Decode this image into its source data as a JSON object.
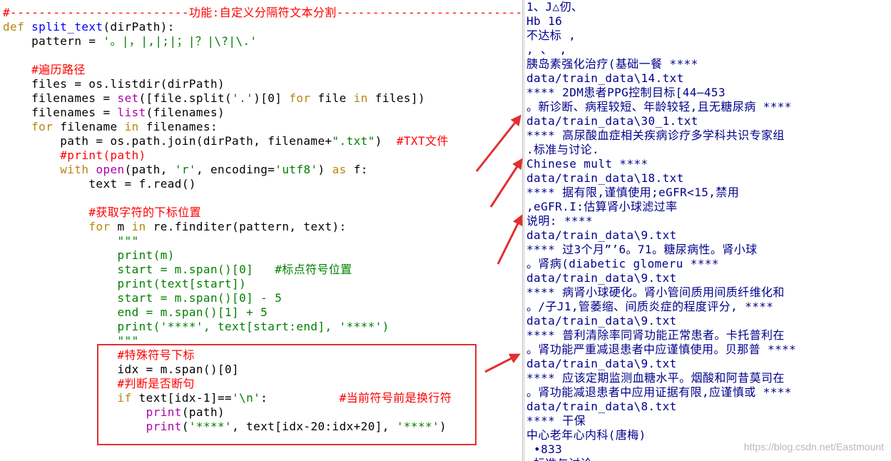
{
  "colors": {
    "comment": "#ff0000",
    "keyword": "#b8860b",
    "builtin": "#b000b0",
    "string": "#008000",
    "def_name": "#0000ff",
    "output_text": "#00008b",
    "annotation": "#e03030"
  },
  "editor": {
    "lines": [
      [
        {
          "t": "#-------------------------功能:自定义分隔符文本分割-----------------------------------",
          "c": "comment"
        }
      ],
      [
        {
          "t": "def ",
          "c": "keyword"
        },
        {
          "t": "split_text",
          "c": "defname"
        },
        {
          "t": "(dirPath):",
          "c": "plain"
        }
      ],
      [
        {
          "t": "    pattern = ",
          "c": "plain"
        },
        {
          "t": "'。|，|,|;|；|？|\\?|\\.'",
          "c": "string"
        }
      ],
      [],
      [
        {
          "t": "    #遍历路径",
          "c": "comment"
        }
      ],
      [
        {
          "t": "    files = os.listdir(dirPath)",
          "c": "plain"
        }
      ],
      [
        {
          "t": "    filenames = ",
          "c": "plain"
        },
        {
          "t": "set",
          "c": "builtin"
        },
        {
          "t": "([file.split(",
          "c": "plain"
        },
        {
          "t": "'.'",
          "c": "string"
        },
        {
          "t": ")[0] ",
          "c": "plain"
        },
        {
          "t": "for",
          "c": "keyword"
        },
        {
          "t": " file ",
          "c": "plain"
        },
        {
          "t": "in",
          "c": "keyword"
        },
        {
          "t": " files])",
          "c": "plain"
        }
      ],
      [
        {
          "t": "    filenames = ",
          "c": "plain"
        },
        {
          "t": "list",
          "c": "builtin"
        },
        {
          "t": "(filenames)",
          "c": "plain"
        }
      ],
      [
        {
          "t": "    ",
          "c": "plain"
        },
        {
          "t": "for",
          "c": "keyword"
        },
        {
          "t": " filename ",
          "c": "plain"
        },
        {
          "t": "in",
          "c": "keyword"
        },
        {
          "t": " filenames:",
          "c": "plain"
        }
      ],
      [
        {
          "t": "        path = os.path.join(dirPath, filename+",
          "c": "plain"
        },
        {
          "t": "\".txt\"",
          "c": "string"
        },
        {
          "t": ")  ",
          "c": "plain"
        },
        {
          "t": "#TXT文件",
          "c": "comment"
        }
      ],
      [
        {
          "t": "        #print(path)",
          "c": "comment"
        }
      ],
      [
        {
          "t": "        ",
          "c": "plain"
        },
        {
          "t": "with",
          "c": "keyword"
        },
        {
          "t": " ",
          "c": "plain"
        },
        {
          "t": "open",
          "c": "builtin"
        },
        {
          "t": "(path, ",
          "c": "plain"
        },
        {
          "t": "'r'",
          "c": "string"
        },
        {
          "t": ", encoding=",
          "c": "plain"
        },
        {
          "t": "'utf8'",
          "c": "string"
        },
        {
          "t": ") ",
          "c": "plain"
        },
        {
          "t": "as",
          "c": "keyword"
        },
        {
          "t": " f:",
          "c": "plain"
        }
      ],
      [
        {
          "t": "            text = f.read()",
          "c": "plain"
        }
      ],
      [],
      [
        {
          "t": "            #获取字符的下标位置",
          "c": "comment"
        }
      ],
      [
        {
          "t": "            ",
          "c": "plain"
        },
        {
          "t": "for",
          "c": "keyword"
        },
        {
          "t": " m ",
          "c": "plain"
        },
        {
          "t": "in",
          "c": "keyword"
        },
        {
          "t": " re.finditer(pattern, text):",
          "c": "plain"
        }
      ],
      [
        {
          "t": "                \"\"\"",
          "c": "string"
        }
      ],
      [
        {
          "t": "                print(m)",
          "c": "string"
        }
      ],
      [
        {
          "t": "                start = m.span()[0]   #标点符号位置",
          "c": "string"
        }
      ],
      [
        {
          "t": "                print(text[start])",
          "c": "string"
        }
      ],
      [
        {
          "t": "                start = m.span()[0] - 5",
          "c": "string"
        }
      ],
      [
        {
          "t": "                end = m.span()[1] + 5",
          "c": "string"
        }
      ],
      [
        {
          "t": "                print('****', text[start:end], '****')",
          "c": "string"
        }
      ],
      [
        {
          "t": "                \"\"\"",
          "c": "string"
        }
      ],
      [
        {
          "t": "                #特殊符号下标",
          "c": "comment"
        }
      ],
      [
        {
          "t": "                idx = m.span()[0]",
          "c": "plain"
        }
      ],
      [
        {
          "t": "                #判断是否断句",
          "c": "comment"
        }
      ],
      [
        {
          "t": "                ",
          "c": "plain"
        },
        {
          "t": "if",
          "c": "keyword"
        },
        {
          "t": " text[idx-1]==",
          "c": "plain"
        },
        {
          "t": "'\\n'",
          "c": "string"
        },
        {
          "t": ":          ",
          "c": "plain"
        },
        {
          "t": "#当前符号前是换行符",
          "c": "comment"
        }
      ],
      [
        {
          "t": "                    ",
          "c": "plain"
        },
        {
          "t": "print",
          "c": "builtin"
        },
        {
          "t": "(path)",
          "c": "plain"
        }
      ],
      [
        {
          "t": "                    ",
          "c": "plain"
        },
        {
          "t": "print",
          "c": "builtin"
        },
        {
          "t": "(",
          "c": "plain"
        },
        {
          "t": "'****'",
          "c": "string"
        },
        {
          "t": ", text[idx-20:idx+20], ",
          "c": "plain"
        },
        {
          "t": "'****'",
          "c": "string"
        },
        {
          "t": ")",
          "c": "plain"
        }
      ]
    ]
  },
  "output": {
    "lines": [
      "1、J△仞、",
      "Hb 16",
      "不达标 ,",
      ", 、 ,",
      "胰岛素强化治疗(基础一餐 ****",
      "data/train_data\\14.txt",
      "**** 2DM患者PPG控制目标[44—453",
      "。新诊断、病程较短、年龄较轻,且无糖尿病 ****",
      "data/train_data\\30_1.txt",
      "**** 高尿酸血症相关疾病诊疗多学科共识专家组",
      ".标准与讨论.",
      "Chinese mult ****",
      "data/train_data\\18.txt",
      "**** 据有限,谨慎使用;eGFR<15,禁用",
      ",eGFR.I:估算肾小球滤过率",
      "说明: ****",
      "data/train_data\\9.txt",
      "**** 过3个月”’6。71。糖尿病性。肾小球",
      "。肾病(diabetic glomeru ****",
      "data/train_data\\9.txt",
      "**** 病肾小球硬化。肾小管间质用间质纤维化和",
      "。/子J1,管萎缩、间质炎症的程度评分, ****",
      "data/train_data\\9.txt",
      "**** 普利清除率同肾功能正常患者。卡托普利在",
      "。肾功能严重减退患者中应谨慎使用。贝那普 ****",
      "data/train_data\\9.txt",
      "**** 应该定期监测血糖水平。烟酸和阿昔莫司在",
      "。肾功能减退患者中应用证据有限,应谨慎或 ****",
      "data/train_data\\8.txt",
      "**** 干保",
      "中心老年心内科(唐梅)",
      " •833",
      " 标准与讨论"
    ]
  },
  "watermark": "https://blog.csdn.net/Eastmount"
}
